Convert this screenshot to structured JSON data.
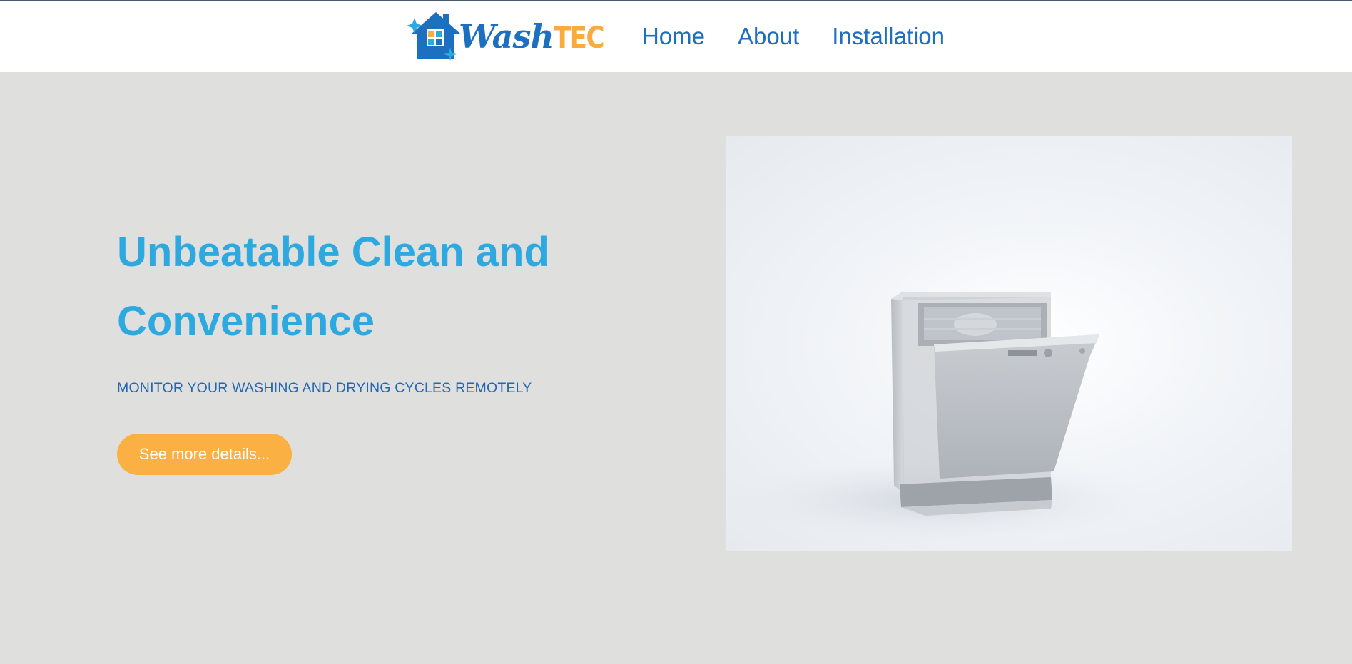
{
  "header": {
    "logo": {
      "word_part1": "Wash",
      "word_part2": "TEC",
      "icon": "house-sparkle-logo-icon"
    },
    "nav": [
      {
        "label": "Home"
      },
      {
        "label": "About"
      },
      {
        "label": "Installation"
      }
    ]
  },
  "hero": {
    "title_line1": "Unbeatable Clean and",
    "title_line2": "Convenience",
    "subtitle": "MONITOR YOUR WASHING AND DRYING CYCLES REMOTELY",
    "cta_label": "See more details...",
    "image": "dishwasher-photo"
  },
  "colors": {
    "background": "#dfe0de",
    "title": "#2ea9e0",
    "nav": "#1e6fbf",
    "accent": "#fbb044"
  }
}
